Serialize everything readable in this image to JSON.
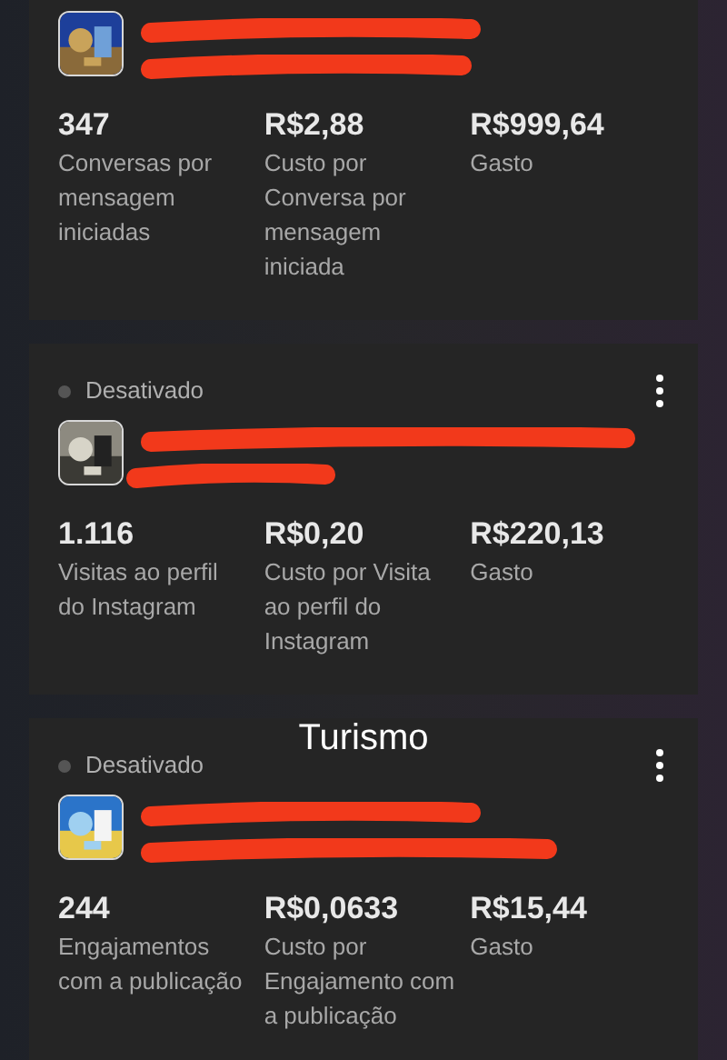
{
  "cards": [
    {
      "metrics": [
        {
          "value": "347",
          "label": "Conversas por mensagem iniciadas"
        },
        {
          "value": "R$2,88",
          "label": "Custo por Conversa por mensagem iniciada"
        },
        {
          "value": "R$999,64",
          "label": "Gasto"
        }
      ]
    },
    {
      "status": "Desativado",
      "active": false,
      "metrics": [
        {
          "value": "1.116",
          "label": "Visitas ao perfil do Instagram"
        },
        {
          "value": "R$0,20",
          "label": "Custo por Visita ao perfil do Instagram"
        },
        {
          "value": "R$220,13",
          "label": "Gasto"
        }
      ]
    },
    {
      "status": "Desativado",
      "active": false,
      "caption": "Turismo",
      "metrics": [
        {
          "value": "244",
          "label": "Engajamentos com a publicação"
        },
        {
          "value": "R$0,0633",
          "label": "Custo por Engajamento com a publicação"
        },
        {
          "value": "R$15,44",
          "label": "Gasto"
        }
      ]
    }
  ]
}
